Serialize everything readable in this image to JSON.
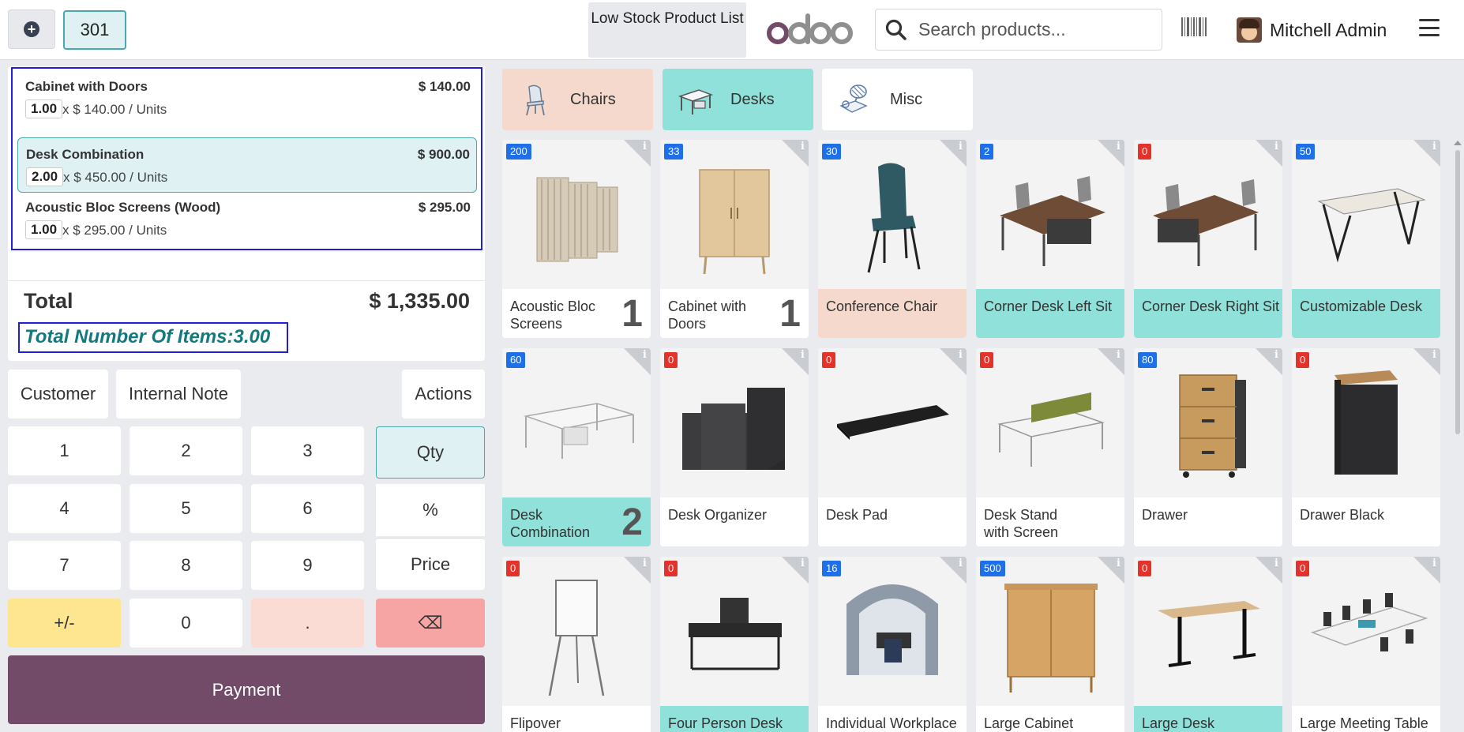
{
  "header": {
    "order_number": "301",
    "low_stock_label": "Low Stock Product List",
    "search_placeholder": "Search products...",
    "user_name": "Mitchell Admin"
  },
  "orderlines": [
    {
      "name": "Cabinet with Doors",
      "price": "$ 140.00",
      "qty": "1.00",
      "unit": "x $ 140.00 / Units",
      "selected": false
    },
    {
      "name": "Desk Combination",
      "price": "$ 900.00",
      "qty": "2.00",
      "unit": "x $ 450.00 / Units",
      "selected": true
    },
    {
      "name": "Acoustic Bloc Screens (Wood)",
      "price": "$ 295.00",
      "qty": "1.00",
      "unit": "x $ 295.00 / Units",
      "selected": false
    }
  ],
  "summary": {
    "total_label": "Total",
    "total_value": "$ 1,335.00",
    "items_text": "Total Number Of Items:3.00"
  },
  "controls": {
    "customer": "Customer",
    "internal_note": "Internal Note",
    "actions": "Actions"
  },
  "numpad": {
    "k1": "1",
    "k2": "2",
    "k3": "3",
    "k4": "4",
    "k5": "5",
    "k6": "6",
    "k7": "7",
    "k8": "8",
    "k9": "9",
    "sign": "+/-",
    "k0": "0",
    "dot": ".",
    "qty": "Qty",
    "disc": "%",
    "price": "Price",
    "backspace": "⌫"
  },
  "payment_label": "Payment",
  "categories": [
    {
      "name": "Chairs",
      "color": "#f6d9cd"
    },
    {
      "name": "Desks",
      "color": "#8fe1da"
    },
    {
      "name": "Misc",
      "color": "#ffffff"
    }
  ],
  "products": [
    {
      "name": "Acoustic Bloc Screens",
      "stock": "200",
      "stock_color": "blue",
      "count": "1",
      "tag": ""
    },
    {
      "name": "Cabinet with Doors",
      "stock": "33",
      "stock_color": "blue",
      "count": "1",
      "tag": ""
    },
    {
      "name": "Conference Chair",
      "stock": "30",
      "stock_color": "blue",
      "count": "",
      "tag": "peach"
    },
    {
      "name": "Corner Desk Left Sit",
      "stock": "2",
      "stock_color": "blue",
      "count": "",
      "tag": "teal"
    },
    {
      "name": "Corner Desk Right Sit",
      "stock": "0",
      "stock_color": "red",
      "count": "",
      "tag": "teal"
    },
    {
      "name": "Customizable Desk",
      "stock": "50",
      "stock_color": "blue",
      "count": "",
      "tag": "teal"
    },
    {
      "name": "Desk Combination",
      "stock": "60",
      "stock_color": "blue",
      "count": "2",
      "tag": "teal"
    },
    {
      "name": "Desk Organizer",
      "stock": "0",
      "stock_color": "red",
      "count": "",
      "tag": ""
    },
    {
      "name": "Desk Pad",
      "stock": "0",
      "stock_color": "red",
      "count": "",
      "tag": ""
    },
    {
      "name": "Desk Stand with Screen",
      "stock": "0",
      "stock_color": "red",
      "count": "",
      "tag": ""
    },
    {
      "name": "Drawer",
      "stock": "80",
      "stock_color": "blue",
      "count": "",
      "tag": ""
    },
    {
      "name": "Drawer Black",
      "stock": "0",
      "stock_color": "red",
      "count": "",
      "tag": ""
    },
    {
      "name": "Flipover",
      "stock": "0",
      "stock_color": "red",
      "count": "",
      "tag": ""
    },
    {
      "name": "Four Person Desk",
      "stock": "0",
      "stock_color": "red",
      "count": "",
      "tag": "teal"
    },
    {
      "name": "Individual Workplace",
      "stock": "16",
      "stock_color": "blue",
      "count": "",
      "tag": ""
    },
    {
      "name": "Large Cabinet",
      "stock": "500",
      "stock_color": "blue",
      "count": "",
      "tag": ""
    },
    {
      "name": "Large Desk",
      "stock": "0",
      "stock_color": "red",
      "count": "",
      "tag": "teal"
    },
    {
      "name": "Large Meeting Table",
      "stock": "0",
      "stock_color": "red",
      "count": "",
      "tag": ""
    }
  ],
  "colors": {
    "accent_teal": "#4aa8ab",
    "payment": "#714b67",
    "highlight_box": "#2020d8",
    "stock_blue": "#1f6fe8",
    "stock_red": "#e4322b"
  }
}
